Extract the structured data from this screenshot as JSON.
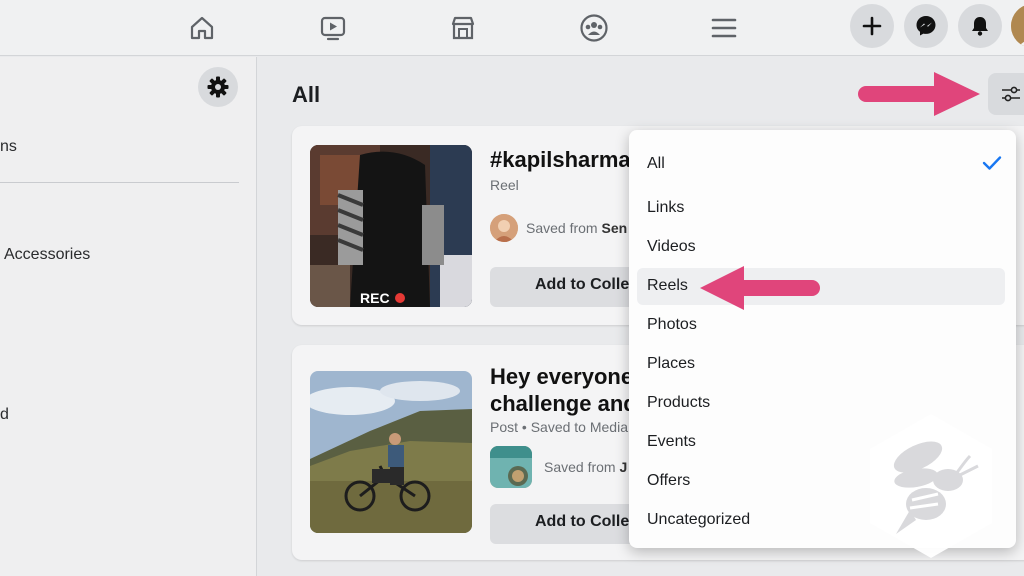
{
  "topbar": {
    "icons": [
      "home-icon",
      "watch-video-icon",
      "marketplace-icon",
      "groups-icon",
      "menu-icon"
    ],
    "actions": [
      "create-plus-icon",
      "messenger-icon",
      "notifications-bell-icon"
    ]
  },
  "sidebar": {
    "settings_icon": "gear-icon",
    "items": [
      {
        "label": "ns"
      },
      {
        "label": "Accessories"
      },
      {
        "label": "d"
      }
    ]
  },
  "main": {
    "title": "All",
    "filter_icon": "filter-sliders-icon"
  },
  "cards": [
    {
      "title": "#kapilsharma",
      "subtitle": "Reel",
      "saved_prefix": "Saved from",
      "saved_source": "Sen",
      "button": "Add to Colle"
    },
    {
      "title_line1": "Hey everyone",
      "title_line2": "challenge and",
      "subtitle": "Post • Saved to Media",
      "saved_prefix": "Saved from",
      "saved_source": "J",
      "button": "Add to Colle"
    }
  ],
  "dropdown": {
    "items": [
      {
        "label": "All",
        "selected": true
      },
      {
        "label": "Links",
        "selected": false
      },
      {
        "label": "Videos",
        "selected": false
      },
      {
        "label": "Reels",
        "selected": false
      },
      {
        "label": "Photos",
        "selected": false
      },
      {
        "label": "Places",
        "selected": false
      },
      {
        "label": "Products",
        "selected": false
      },
      {
        "label": "Events",
        "selected": false
      },
      {
        "label": "Offers",
        "selected": false
      },
      {
        "label": "Uncategorized",
        "selected": false
      }
    ],
    "hovered": "Reels"
  },
  "colors": {
    "accent_arrow": "#e0457b",
    "check_blue": "#1877f2"
  }
}
